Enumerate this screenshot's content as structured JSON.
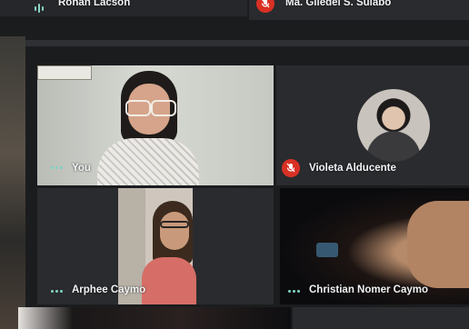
{
  "participants": {
    "top_left": {
      "name": "Ronan Lacson"
    },
    "top_right": {
      "name": "Ma. Gliedel S. Sulabo",
      "muted": true
    },
    "you": {
      "name": "You"
    },
    "violeta": {
      "name": "Violeta Alducente",
      "muted": true
    },
    "arphee": {
      "name": "Arphee Caymo"
    },
    "christian": {
      "name": "Christian Nomer Caymo"
    }
  },
  "icons": {
    "audio_active": "audio-level-icon",
    "more": "more-dots-icon",
    "muted": "mic-off-icon"
  },
  "colors": {
    "background": "#1b1c1e",
    "tile": "#2a2b2e",
    "accent": "#7fd3c4",
    "muted_red": "#d93025"
  }
}
